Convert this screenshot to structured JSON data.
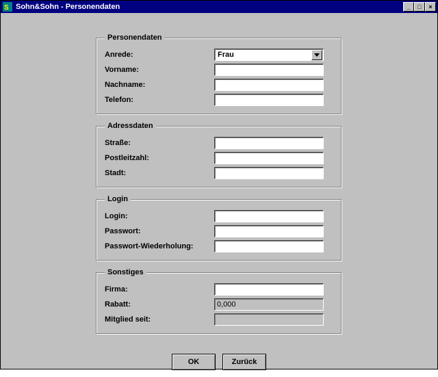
{
  "window": {
    "title": "Sohn&Sohn - Personendaten"
  },
  "groups": {
    "person": {
      "legend": "Personendaten",
      "salutation_label": "Anrede:",
      "salutation_value": "Frau",
      "firstname_label": "Vorname:",
      "firstname_value": "",
      "lastname_label": "Nachname:",
      "lastname_value": "",
      "phone_label": "Telefon:",
      "phone_value": ""
    },
    "address": {
      "legend": "Adressdaten",
      "street_label": "Straße:",
      "street_value": "",
      "zip_label": "Postleitzahl:",
      "zip_value": "",
      "city_label": "Stadt:",
      "city_value": ""
    },
    "login": {
      "legend": "Login",
      "login_label": "Login:",
      "login_value": "",
      "password_label": "Passwort:",
      "password_value": "",
      "password_repeat_label": "Passwort-Wiederholung:",
      "password_repeat_value": ""
    },
    "misc": {
      "legend": "Sonstiges",
      "company_label": "Firma:",
      "company_value": "",
      "discount_label": "Rabatt:",
      "discount_value": "0,000",
      "member_since_label": "Mitglied seit:",
      "member_since_value": ""
    }
  },
  "buttons": {
    "ok": "OK",
    "back": "Zurück"
  }
}
